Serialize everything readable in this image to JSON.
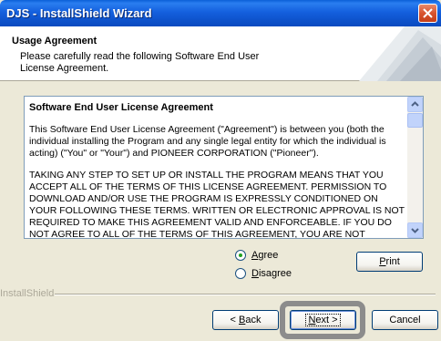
{
  "window": {
    "title": "DJS - InstallShield Wizard"
  },
  "header": {
    "title": "Usage Agreement",
    "subtitle": "Please carefully read the following Software End User License Agreement."
  },
  "license": {
    "heading": "Software End User License Agreement",
    "para1": "This Software End User License Agreement (\"Agreement\") is between you (both the individual installing the Program and any single legal entity for which the individual is acting) (\"You\" or \"Your\") and PIONEER CORPORATION (\"Pioneer\").",
    "para2": "TAKING ANY STEP TO SET UP OR INSTALL THE PROGRAM MEANS THAT YOU ACCEPT ALL OF THE TERMS OF THIS LICENSE AGREEMENT. PERMISSION TO DOWNLOAD AND/OR USE THE PROGRAM IS EXPRESSLY CONDITIONED ON YOUR FOLLOWING THESE TERMS. WRITTEN OR ELECTRONIC APPROVAL IS NOT REQUIRED TO MAKE THIS AGREEMENT VALID AND ENFORCEABLE. IF YOU DO NOT AGREE TO ALL OF THE TERMS OF THIS AGREEMENT, YOU ARE NOT AUTHORIZED TO USE THE"
  },
  "options": {
    "agree": {
      "prefix": "",
      "accel": "A",
      "rest": "gree",
      "selected": true
    },
    "disagree": {
      "prefix": "",
      "accel": "D",
      "rest": "isagree",
      "selected": false
    }
  },
  "buttons": {
    "print": {
      "accel": "P",
      "rest": "rint"
    },
    "back": {
      "prefix": "< ",
      "accel": "B",
      "rest": "ack"
    },
    "next": {
      "accel": "N",
      "rest": "ext >"
    },
    "cancel": "Cancel"
  },
  "footer": {
    "brand": "InstallShield"
  },
  "icons": {
    "close": "close-icon",
    "scroll_up": "arrow-up-icon",
    "scroll_down": "arrow-down-icon"
  },
  "colors": {
    "titlebar": "#0e53cc",
    "close": "#d8532e",
    "dialog": "#ece9d8",
    "highlight": "#8c8c8c"
  }
}
